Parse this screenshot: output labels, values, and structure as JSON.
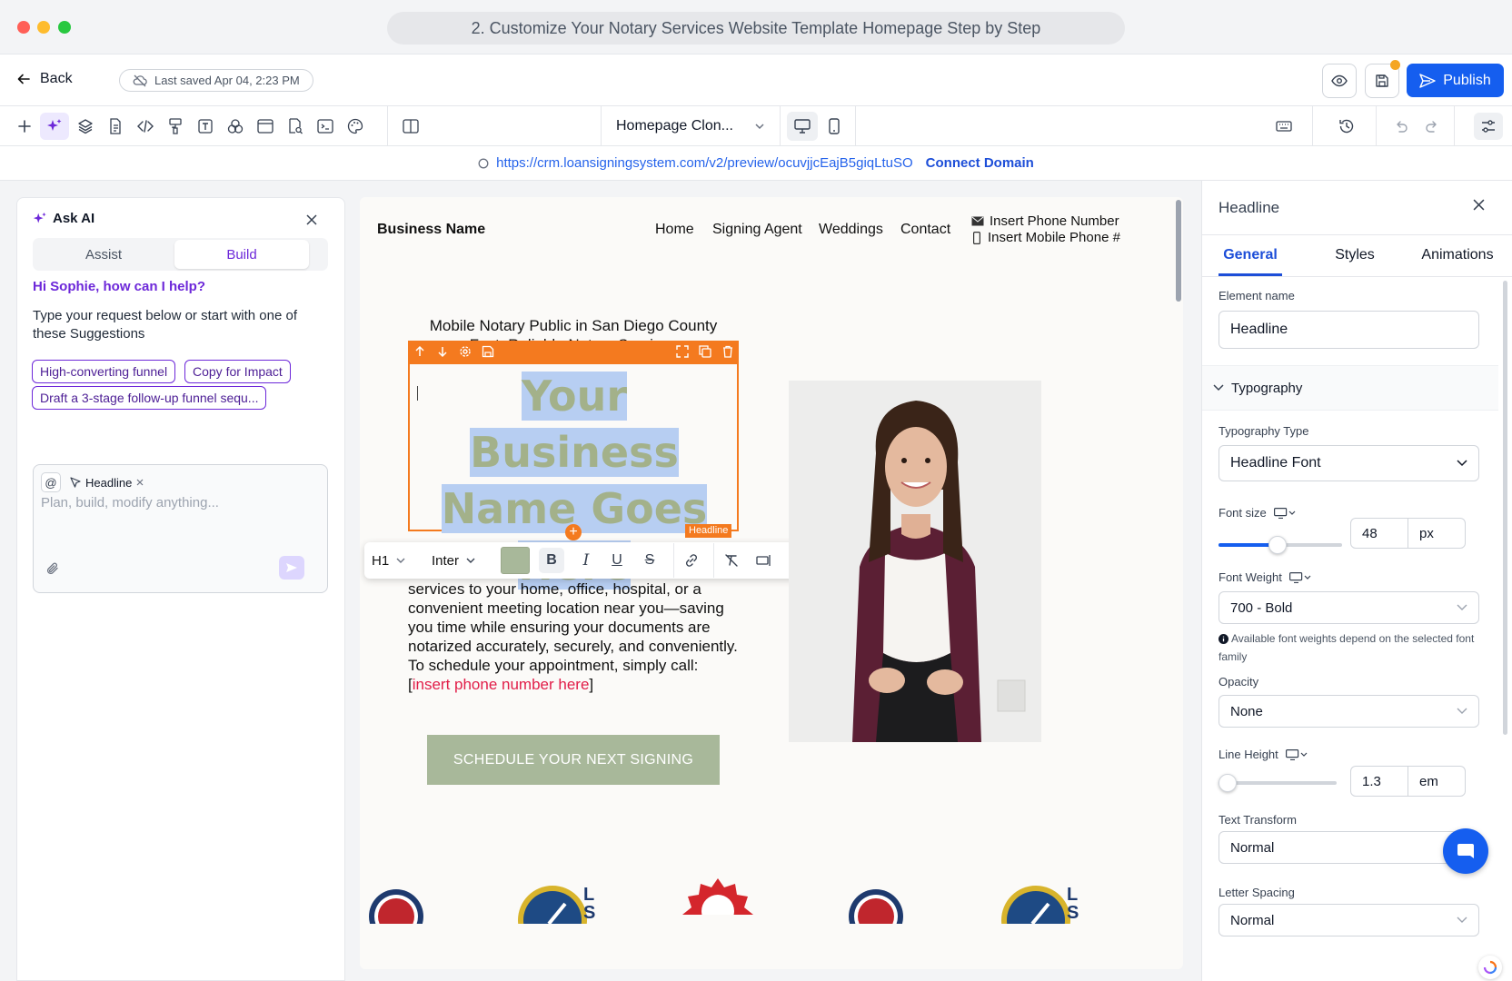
{
  "window": {
    "title": "2. Customize Your Notary Services Website Template Homepage Step by Step"
  },
  "topbar": {
    "back_label": "Back",
    "last_saved": "Last saved Apr 04, 2:23 PM",
    "publish_label": "Publish"
  },
  "toolbar": {
    "page_select": "Homepage Clon..."
  },
  "urlbar": {
    "url": "https://crm.loansigningsystem.com/v2/preview/ocuvjjcEajB5giqLtuSO",
    "connect_label": "Connect Domain"
  },
  "ai_panel": {
    "title": "Ask AI",
    "tabs": [
      "Assist",
      "Build"
    ],
    "active_tab": "Build",
    "greeting": "Hi Sophie, how can I help?",
    "intro": "Type your request below or start with one of these Suggestions",
    "suggestions": [
      "High-converting funnel",
      "Copy for Impact",
      "Draft a 3-stage follow-up funnel sequ..."
    ],
    "context_chip": "Headline",
    "input_placeholder": "Plan, build, modify anything..."
  },
  "site": {
    "business_name": "Business Name",
    "nav": [
      "Home",
      "Signing Agent",
      "Weddings",
      "Contact"
    ],
    "phone": "Insert Phone Number",
    "mobile": "Insert Mobile Phone #",
    "eyebrow_line1": "Mobile Notary Public in San Diego County",
    "eyebrow_line2": "Fast, Reliable Notary Services",
    "headline": "Your Business Name Goes Here",
    "element_tag": "Headline",
    "body_text": "services to your home, office, hospital, or a convenient meeting location near you—saving you time while ensuring your documents are notarized accurately, securely, and conveniently. To schedule your appointment, simply call: [",
    "body_link": "insert phone number here",
    "body_close": "]",
    "cta": "SCHEDULE YOUR NEXT SIGNING",
    "colors": {
      "accent": "#a3b18a",
      "cta": "#a8b89a",
      "link": "#e11d48",
      "selection": "#f47a1f"
    }
  },
  "format_bar": {
    "heading_level": "H1",
    "font": "Inter"
  },
  "props": {
    "title": "Headline",
    "tabs": [
      "General",
      "Styles",
      "Animations"
    ],
    "active_tab": "General",
    "element_name_label": "Element name",
    "element_name_value": "Headline",
    "typography_section": "Typography",
    "typography_type_label": "Typography Type",
    "typography_type_value": "Headline Font",
    "font_size_label": "Font size",
    "font_size_value": "48",
    "font_size_unit": "px",
    "font_size_slider": 0.48,
    "font_weight_label": "Font Weight",
    "font_weight_value": "700 - Bold",
    "font_weight_note": "Available font weights depend on the selected font family",
    "opacity_label": "Opacity",
    "opacity_value": "None",
    "line_height_label": "Line Height",
    "line_height_value": "1.3",
    "line_height_unit": "em",
    "line_height_slider": 0.05,
    "text_transform_label": "Text Transform",
    "text_transform_value": "Normal",
    "letter_spacing_label": "Letter Spacing",
    "letter_spacing_value": "Normal"
  }
}
